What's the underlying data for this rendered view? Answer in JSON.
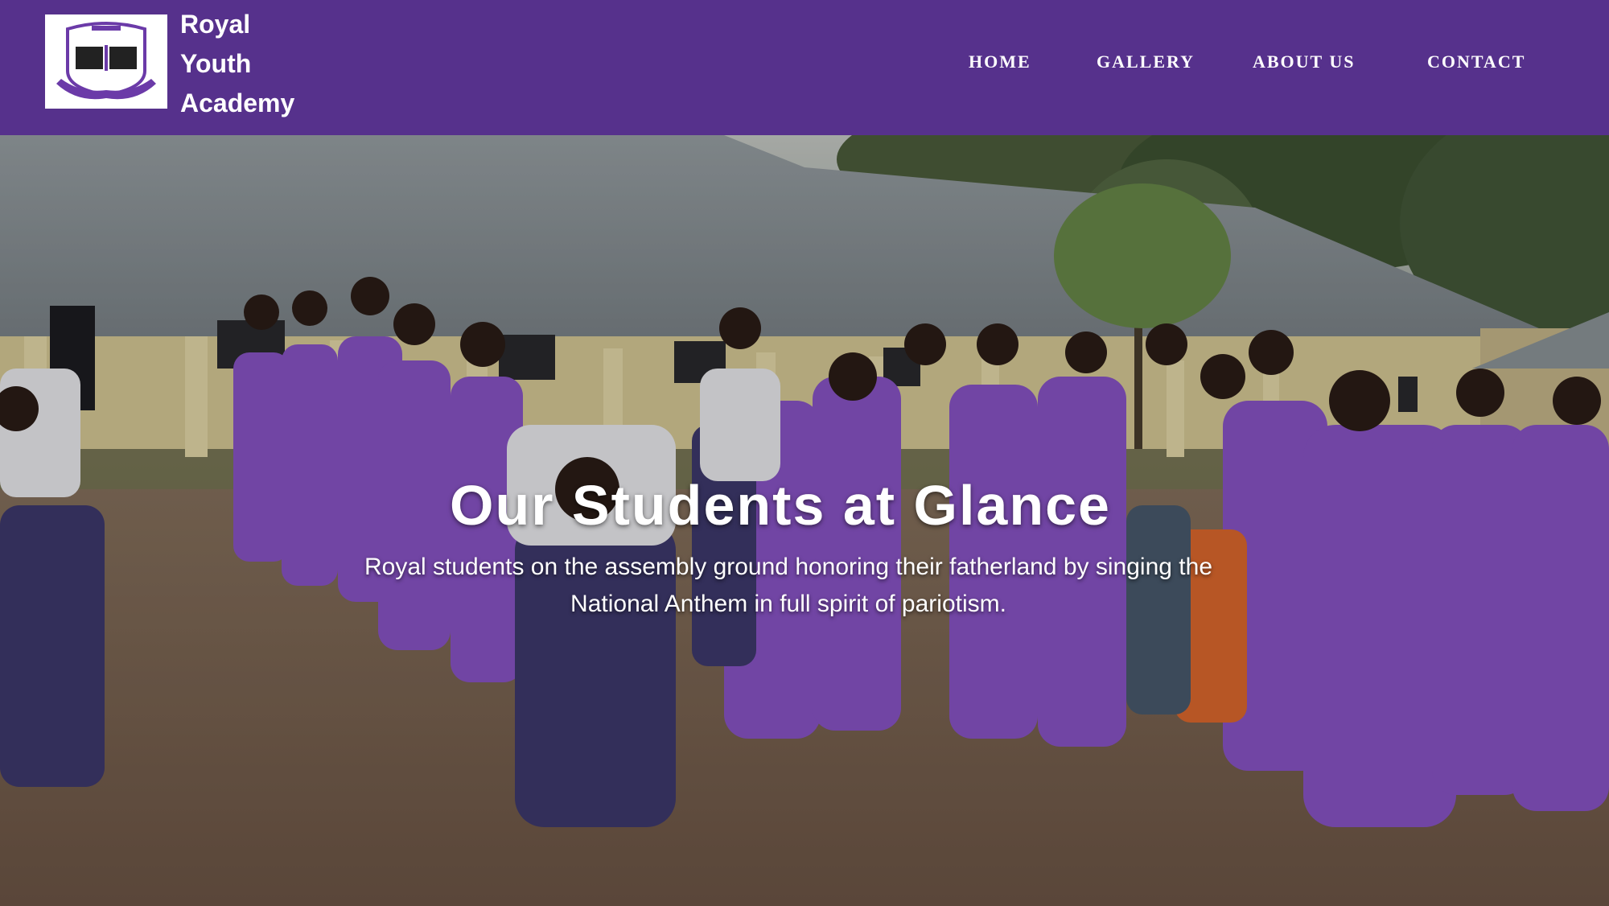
{
  "header": {
    "brand_line1": "Royal",
    "brand_line2": "Youth",
    "brand_line3": "Academy",
    "background_color": "#56318c"
  },
  "nav": {
    "items": [
      {
        "label": "HOME"
      },
      {
        "label": "GALLERY"
      },
      {
        "label": "ABOUT US"
      },
      {
        "label": "CONTACT"
      }
    ]
  },
  "hero": {
    "title": "Our Students at Glance",
    "subtitle": "Royal students on the assembly ground honoring their fatherland by singing the National Anthem in full spirit of pariotism.",
    "uniform_color": "#8a55c8"
  }
}
